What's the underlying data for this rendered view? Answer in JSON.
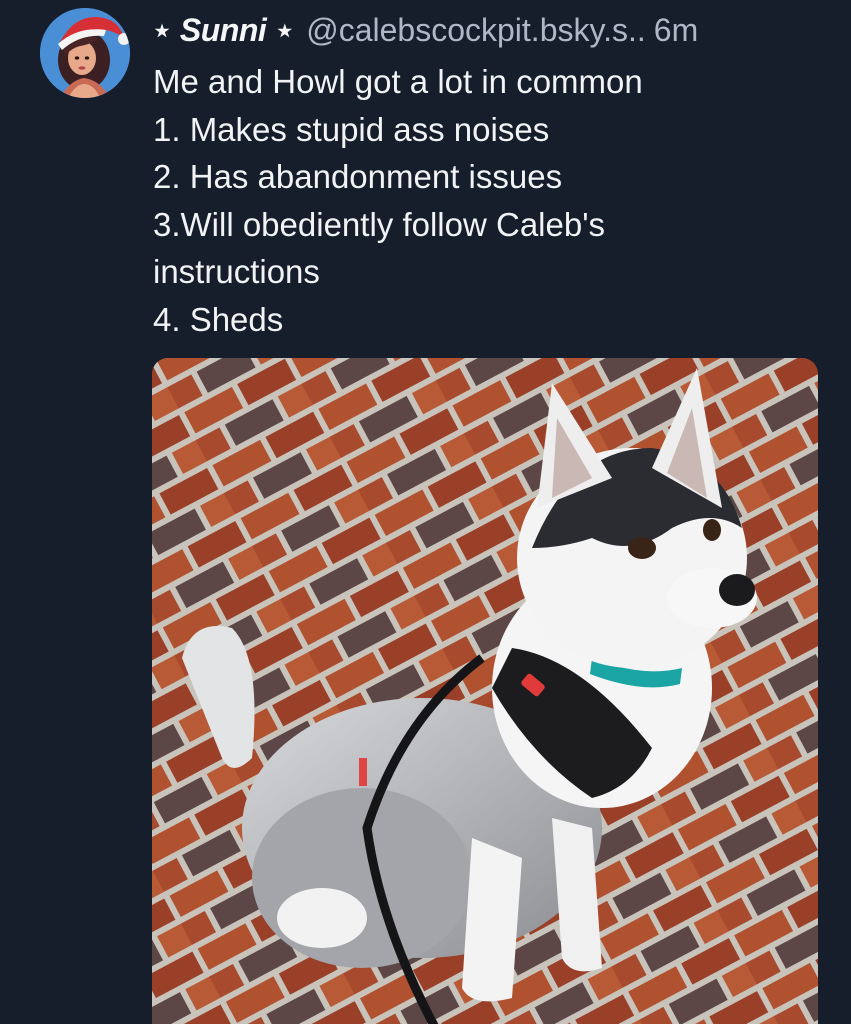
{
  "post": {
    "author": {
      "display_name": "⋆ Sunni ⋆",
      "handle": "@calebscockpit.bsky.s..",
      "avatar_icon": "profile-avatar"
    },
    "time": "6m",
    "text_lines": [
      "Me and Howl got a lot in common",
      "1. Makes stupid ass noises",
      "2. Has abandonment issues",
      "3.Will obediently follow Caleb's",
      "instructions",
      "4. Sheds"
    ],
    "image": {
      "icon": "husky-puppy-photo"
    }
  },
  "colors": {
    "background": "#161e2b",
    "text": "#f1f3f5",
    "muted": "#aeb8c6"
  }
}
